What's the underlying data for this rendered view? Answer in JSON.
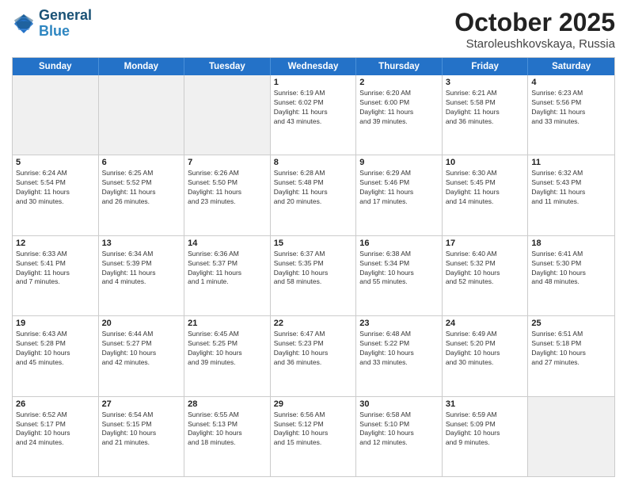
{
  "header": {
    "logo_line1": "General",
    "logo_line2": "Blue",
    "month": "October 2025",
    "location": "Staroleushkovskaya, Russia"
  },
  "weekdays": [
    "Sunday",
    "Monday",
    "Tuesday",
    "Wednesday",
    "Thursday",
    "Friday",
    "Saturday"
  ],
  "rows": [
    [
      {
        "day": "",
        "text": ""
      },
      {
        "day": "",
        "text": ""
      },
      {
        "day": "",
        "text": ""
      },
      {
        "day": "1",
        "text": "Sunrise: 6:19 AM\nSunset: 6:02 PM\nDaylight: 11 hours\nand 43 minutes."
      },
      {
        "day": "2",
        "text": "Sunrise: 6:20 AM\nSunset: 6:00 PM\nDaylight: 11 hours\nand 39 minutes."
      },
      {
        "day": "3",
        "text": "Sunrise: 6:21 AM\nSunset: 5:58 PM\nDaylight: 11 hours\nand 36 minutes."
      },
      {
        "day": "4",
        "text": "Sunrise: 6:23 AM\nSunset: 5:56 PM\nDaylight: 11 hours\nand 33 minutes."
      }
    ],
    [
      {
        "day": "5",
        "text": "Sunrise: 6:24 AM\nSunset: 5:54 PM\nDaylight: 11 hours\nand 30 minutes."
      },
      {
        "day": "6",
        "text": "Sunrise: 6:25 AM\nSunset: 5:52 PM\nDaylight: 11 hours\nand 26 minutes."
      },
      {
        "day": "7",
        "text": "Sunrise: 6:26 AM\nSunset: 5:50 PM\nDaylight: 11 hours\nand 23 minutes."
      },
      {
        "day": "8",
        "text": "Sunrise: 6:28 AM\nSunset: 5:48 PM\nDaylight: 11 hours\nand 20 minutes."
      },
      {
        "day": "9",
        "text": "Sunrise: 6:29 AM\nSunset: 5:46 PM\nDaylight: 11 hours\nand 17 minutes."
      },
      {
        "day": "10",
        "text": "Sunrise: 6:30 AM\nSunset: 5:45 PM\nDaylight: 11 hours\nand 14 minutes."
      },
      {
        "day": "11",
        "text": "Sunrise: 6:32 AM\nSunset: 5:43 PM\nDaylight: 11 hours\nand 11 minutes."
      }
    ],
    [
      {
        "day": "12",
        "text": "Sunrise: 6:33 AM\nSunset: 5:41 PM\nDaylight: 11 hours\nand 7 minutes."
      },
      {
        "day": "13",
        "text": "Sunrise: 6:34 AM\nSunset: 5:39 PM\nDaylight: 11 hours\nand 4 minutes."
      },
      {
        "day": "14",
        "text": "Sunrise: 6:36 AM\nSunset: 5:37 PM\nDaylight: 11 hours\nand 1 minute."
      },
      {
        "day": "15",
        "text": "Sunrise: 6:37 AM\nSunset: 5:35 PM\nDaylight: 10 hours\nand 58 minutes."
      },
      {
        "day": "16",
        "text": "Sunrise: 6:38 AM\nSunset: 5:34 PM\nDaylight: 10 hours\nand 55 minutes."
      },
      {
        "day": "17",
        "text": "Sunrise: 6:40 AM\nSunset: 5:32 PM\nDaylight: 10 hours\nand 52 minutes."
      },
      {
        "day": "18",
        "text": "Sunrise: 6:41 AM\nSunset: 5:30 PM\nDaylight: 10 hours\nand 48 minutes."
      }
    ],
    [
      {
        "day": "19",
        "text": "Sunrise: 6:43 AM\nSunset: 5:28 PM\nDaylight: 10 hours\nand 45 minutes."
      },
      {
        "day": "20",
        "text": "Sunrise: 6:44 AM\nSunset: 5:27 PM\nDaylight: 10 hours\nand 42 minutes."
      },
      {
        "day": "21",
        "text": "Sunrise: 6:45 AM\nSunset: 5:25 PM\nDaylight: 10 hours\nand 39 minutes."
      },
      {
        "day": "22",
        "text": "Sunrise: 6:47 AM\nSunset: 5:23 PM\nDaylight: 10 hours\nand 36 minutes."
      },
      {
        "day": "23",
        "text": "Sunrise: 6:48 AM\nSunset: 5:22 PM\nDaylight: 10 hours\nand 33 minutes."
      },
      {
        "day": "24",
        "text": "Sunrise: 6:49 AM\nSunset: 5:20 PM\nDaylight: 10 hours\nand 30 minutes."
      },
      {
        "day": "25",
        "text": "Sunrise: 6:51 AM\nSunset: 5:18 PM\nDaylight: 10 hours\nand 27 minutes."
      }
    ],
    [
      {
        "day": "26",
        "text": "Sunrise: 6:52 AM\nSunset: 5:17 PM\nDaylight: 10 hours\nand 24 minutes."
      },
      {
        "day": "27",
        "text": "Sunrise: 6:54 AM\nSunset: 5:15 PM\nDaylight: 10 hours\nand 21 minutes."
      },
      {
        "day": "28",
        "text": "Sunrise: 6:55 AM\nSunset: 5:13 PM\nDaylight: 10 hours\nand 18 minutes."
      },
      {
        "day": "29",
        "text": "Sunrise: 6:56 AM\nSunset: 5:12 PM\nDaylight: 10 hours\nand 15 minutes."
      },
      {
        "day": "30",
        "text": "Sunrise: 6:58 AM\nSunset: 5:10 PM\nDaylight: 10 hours\nand 12 minutes."
      },
      {
        "day": "31",
        "text": "Sunrise: 6:59 AM\nSunset: 5:09 PM\nDaylight: 10 hours\nand 9 minutes."
      },
      {
        "day": "",
        "text": ""
      }
    ]
  ]
}
